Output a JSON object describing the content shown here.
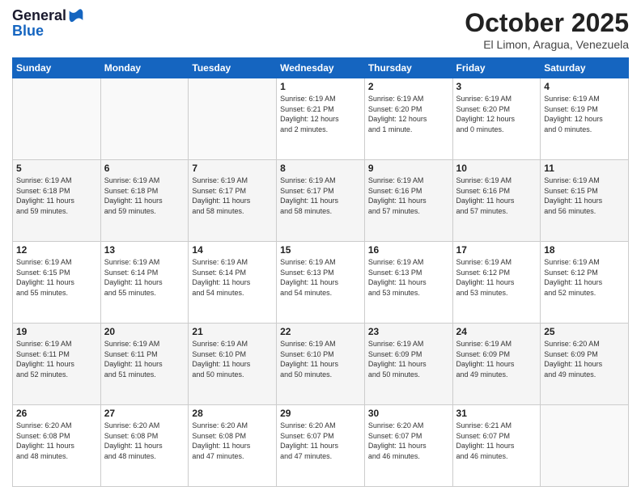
{
  "header": {
    "logo_line1": "General",
    "logo_line2": "Blue",
    "month_title": "October 2025",
    "location": "El Limon, Aragua, Venezuela"
  },
  "weekdays": [
    "Sunday",
    "Monday",
    "Tuesday",
    "Wednesday",
    "Thursday",
    "Friday",
    "Saturday"
  ],
  "weeks": [
    [
      {
        "day": "",
        "info": ""
      },
      {
        "day": "",
        "info": ""
      },
      {
        "day": "",
        "info": ""
      },
      {
        "day": "1",
        "info": "Sunrise: 6:19 AM\nSunset: 6:21 PM\nDaylight: 12 hours\nand 2 minutes."
      },
      {
        "day": "2",
        "info": "Sunrise: 6:19 AM\nSunset: 6:20 PM\nDaylight: 12 hours\nand 1 minute."
      },
      {
        "day": "3",
        "info": "Sunrise: 6:19 AM\nSunset: 6:20 PM\nDaylight: 12 hours\nand 0 minutes."
      },
      {
        "day": "4",
        "info": "Sunrise: 6:19 AM\nSunset: 6:19 PM\nDaylight: 12 hours\nand 0 minutes."
      }
    ],
    [
      {
        "day": "5",
        "info": "Sunrise: 6:19 AM\nSunset: 6:18 PM\nDaylight: 11 hours\nand 59 minutes."
      },
      {
        "day": "6",
        "info": "Sunrise: 6:19 AM\nSunset: 6:18 PM\nDaylight: 11 hours\nand 59 minutes."
      },
      {
        "day": "7",
        "info": "Sunrise: 6:19 AM\nSunset: 6:17 PM\nDaylight: 11 hours\nand 58 minutes."
      },
      {
        "day": "8",
        "info": "Sunrise: 6:19 AM\nSunset: 6:17 PM\nDaylight: 11 hours\nand 58 minutes."
      },
      {
        "day": "9",
        "info": "Sunrise: 6:19 AM\nSunset: 6:16 PM\nDaylight: 11 hours\nand 57 minutes."
      },
      {
        "day": "10",
        "info": "Sunrise: 6:19 AM\nSunset: 6:16 PM\nDaylight: 11 hours\nand 57 minutes."
      },
      {
        "day": "11",
        "info": "Sunrise: 6:19 AM\nSunset: 6:15 PM\nDaylight: 11 hours\nand 56 minutes."
      }
    ],
    [
      {
        "day": "12",
        "info": "Sunrise: 6:19 AM\nSunset: 6:15 PM\nDaylight: 11 hours\nand 55 minutes."
      },
      {
        "day": "13",
        "info": "Sunrise: 6:19 AM\nSunset: 6:14 PM\nDaylight: 11 hours\nand 55 minutes."
      },
      {
        "day": "14",
        "info": "Sunrise: 6:19 AM\nSunset: 6:14 PM\nDaylight: 11 hours\nand 54 minutes."
      },
      {
        "day": "15",
        "info": "Sunrise: 6:19 AM\nSunset: 6:13 PM\nDaylight: 11 hours\nand 54 minutes."
      },
      {
        "day": "16",
        "info": "Sunrise: 6:19 AM\nSunset: 6:13 PM\nDaylight: 11 hours\nand 53 minutes."
      },
      {
        "day": "17",
        "info": "Sunrise: 6:19 AM\nSunset: 6:12 PM\nDaylight: 11 hours\nand 53 minutes."
      },
      {
        "day": "18",
        "info": "Sunrise: 6:19 AM\nSunset: 6:12 PM\nDaylight: 11 hours\nand 52 minutes."
      }
    ],
    [
      {
        "day": "19",
        "info": "Sunrise: 6:19 AM\nSunset: 6:11 PM\nDaylight: 11 hours\nand 52 minutes."
      },
      {
        "day": "20",
        "info": "Sunrise: 6:19 AM\nSunset: 6:11 PM\nDaylight: 11 hours\nand 51 minutes."
      },
      {
        "day": "21",
        "info": "Sunrise: 6:19 AM\nSunset: 6:10 PM\nDaylight: 11 hours\nand 50 minutes."
      },
      {
        "day": "22",
        "info": "Sunrise: 6:19 AM\nSunset: 6:10 PM\nDaylight: 11 hours\nand 50 minutes."
      },
      {
        "day": "23",
        "info": "Sunrise: 6:19 AM\nSunset: 6:09 PM\nDaylight: 11 hours\nand 50 minutes."
      },
      {
        "day": "24",
        "info": "Sunrise: 6:19 AM\nSunset: 6:09 PM\nDaylight: 11 hours\nand 49 minutes."
      },
      {
        "day": "25",
        "info": "Sunrise: 6:20 AM\nSunset: 6:09 PM\nDaylight: 11 hours\nand 49 minutes."
      }
    ],
    [
      {
        "day": "26",
        "info": "Sunrise: 6:20 AM\nSunset: 6:08 PM\nDaylight: 11 hours\nand 48 minutes."
      },
      {
        "day": "27",
        "info": "Sunrise: 6:20 AM\nSunset: 6:08 PM\nDaylight: 11 hours\nand 48 minutes."
      },
      {
        "day": "28",
        "info": "Sunrise: 6:20 AM\nSunset: 6:08 PM\nDaylight: 11 hours\nand 47 minutes."
      },
      {
        "day": "29",
        "info": "Sunrise: 6:20 AM\nSunset: 6:07 PM\nDaylight: 11 hours\nand 47 minutes."
      },
      {
        "day": "30",
        "info": "Sunrise: 6:20 AM\nSunset: 6:07 PM\nDaylight: 11 hours\nand 46 minutes."
      },
      {
        "day": "31",
        "info": "Sunrise: 6:21 AM\nSunset: 6:07 PM\nDaylight: 11 hours\nand 46 minutes."
      },
      {
        "day": "",
        "info": ""
      }
    ]
  ]
}
